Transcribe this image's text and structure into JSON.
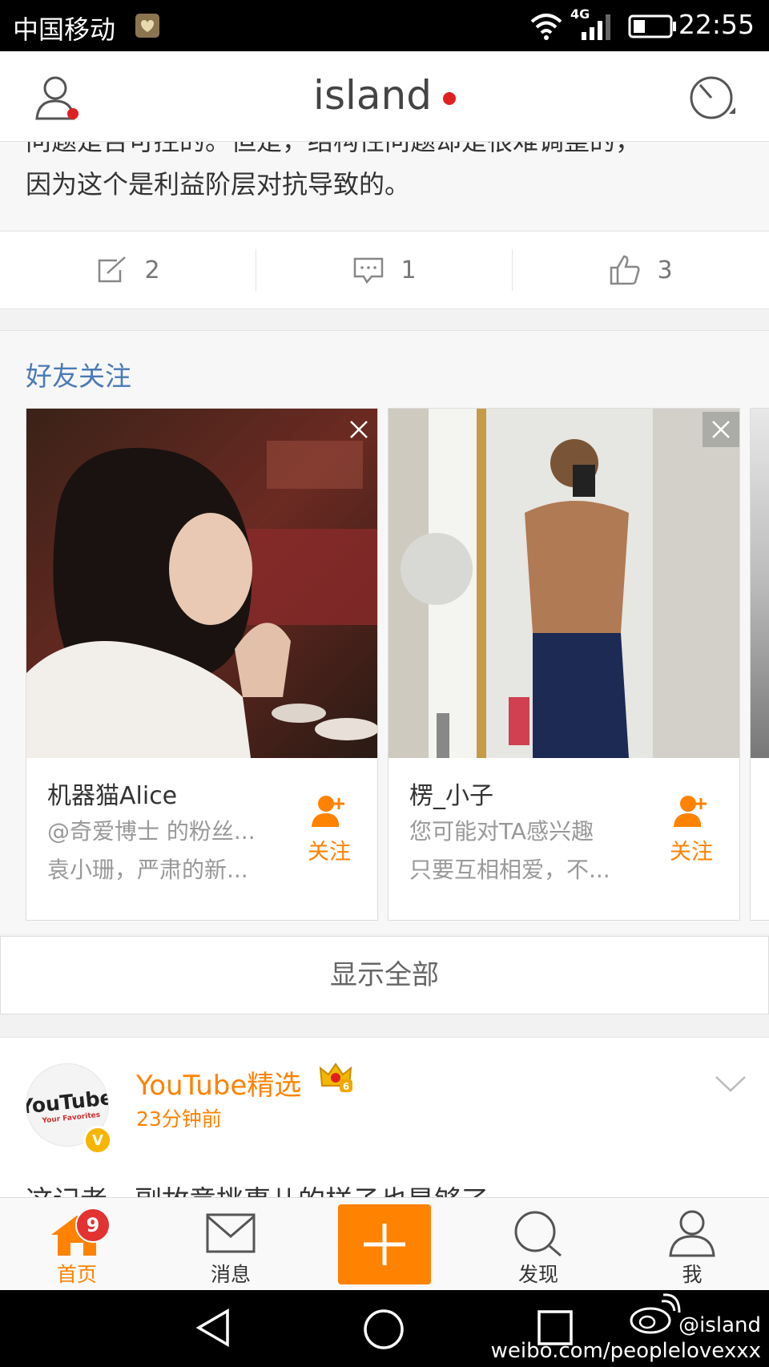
{
  "status_bar": {
    "carrier": "中国移动",
    "network": "4G",
    "time": "22:55"
  },
  "header": {
    "title": "island"
  },
  "post": {
    "text_line1": "问题是否可控的。但是，结构性问题却是很难调整的，",
    "text_line2": "因为这个是利益阶层对抗导致的。",
    "repost_count": "2",
    "comment_count": "1",
    "like_count": "3"
  },
  "friends": {
    "title": "好友关注",
    "cards": [
      {
        "name": "机器猫Alice",
        "line1": "@奇爱博士 的粉丝...",
        "line2": "袁小珊，严肃的新...",
        "follow_label": "关注"
      },
      {
        "name": "楞_小子",
        "line1": "您可能对TA感兴趣",
        "line2": "只要互相相爱，不...",
        "follow_label": "关注"
      }
    ],
    "show_all": "显示全部"
  },
  "next_post": {
    "username": "YouTube精选",
    "time": "23分钟前",
    "text": "这记者一副故意挑事儿的样子也是够了",
    "avatar_text": "YouTube",
    "avatar_subtext": "Your Favorites",
    "verified_mark": "V",
    "crown_level": "6"
  },
  "tabbar": {
    "home": "首页",
    "home_badge": "9",
    "messages": "消息",
    "discover": "发现",
    "me": "我"
  },
  "watermark": {
    "handle": "@island",
    "url": "weibo.com/peoplelovexxx"
  },
  "colors": {
    "accent": "#ff8200",
    "link_blue": "#4a7ab7",
    "notify_red": "#e02020"
  }
}
